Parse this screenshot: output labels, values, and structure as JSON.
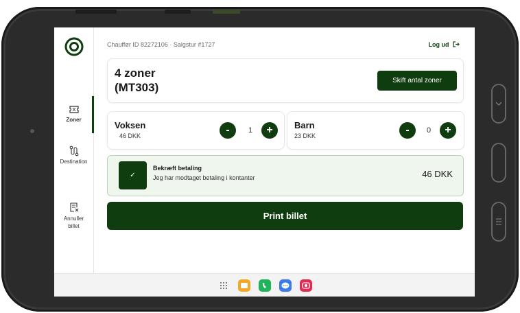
{
  "header": {
    "subtitle": "Chauffør ID 82272106 · Salgstur #1727",
    "logout_label": "Log ud",
    "logout_icon": "logout-arrow-icon"
  },
  "sidebar": {
    "items": [
      {
        "label": "Zoner",
        "icon": "ticket-icon",
        "active": true
      },
      {
        "label": "Destination",
        "icon": "route-icon",
        "active": false
      },
      {
        "label": "Annuller\nbillet",
        "icon": "cancel-receipt-icon",
        "active": false
      }
    ]
  },
  "zones": {
    "title_line1": "4 zoner",
    "title_line2": "(MT303)",
    "change_button": "Skift antal zoner"
  },
  "tickets": [
    {
      "name": "Voksen",
      "price": "46 DKK",
      "quantity": "1",
      "minus": "-",
      "plus": "+"
    },
    {
      "name": "Barn",
      "price": "23 DKK",
      "quantity": "0",
      "minus": "-",
      "plus": "+"
    }
  ],
  "payment": {
    "check_mark": "✓",
    "title": "Bekræft betaling",
    "subtitle": "Jeg har modtaget betaling i kontanter",
    "amount": "46 DKK"
  },
  "print_button": "Print billet",
  "colors": {
    "primary": "#0f3d0f",
    "payment_bg": "#eef6ee"
  },
  "taskbar": {
    "apps": [
      "apps-grid-icon",
      "folder-icon",
      "phone-icon",
      "messages-icon",
      "camera-icon"
    ]
  }
}
